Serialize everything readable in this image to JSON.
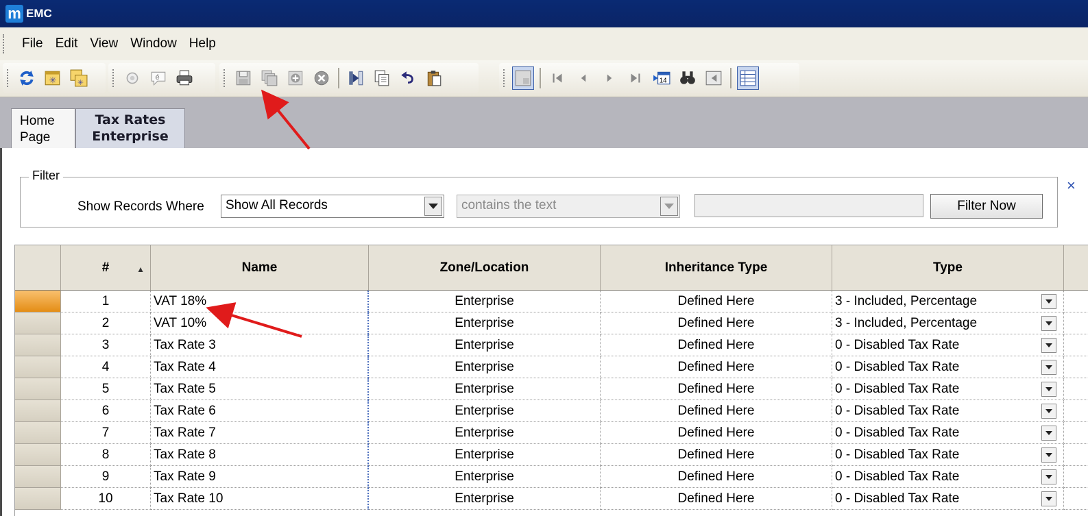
{
  "window": {
    "app_logo": "m",
    "title": "EMC"
  },
  "menu": [
    "File",
    "Edit",
    "View",
    "Window",
    "Help"
  ],
  "toolbar": {
    "icons": [
      "refresh-icon",
      "new-window-icon",
      "multi-window-icon",
      "radio-icon",
      "comment-icon",
      "print-icon",
      "save-icon",
      "save-all-icon",
      "add-record-icon",
      "delete-record-icon",
      "insert-icon",
      "copy-icon",
      "undo-icon",
      "paste-icon",
      "grid-view-icon",
      "first-record-icon",
      "previous-record-icon",
      "next-record-icon",
      "last-record-icon",
      "goto-record-icon",
      "find-icon",
      "table-view-icon",
      "form-view-icon"
    ],
    "goto_badge": "14"
  },
  "tabs": [
    {
      "line1": "Home",
      "line2": "Page"
    },
    {
      "line1": "Tax Rates",
      "line2": "Enterprise"
    }
  ],
  "filter": {
    "legend": "Filter",
    "label": "Show Records Where",
    "field_value": "Show All Records",
    "operator_value": "contains the text",
    "button": "Filter Now",
    "side_link": "×"
  },
  "grid": {
    "columns": [
      "",
      "#",
      "Name",
      "Zone/Location",
      "Inheritance Type",
      "Type"
    ],
    "rows": [
      {
        "num": "1",
        "name": "VAT 18%",
        "zone": "Enterprise",
        "inheritance": "Defined Here",
        "type": "3 - Included, Percentage"
      },
      {
        "num": "2",
        "name": "VAT 10%",
        "zone": "Enterprise",
        "inheritance": "Defined Here",
        "type": "3 - Included, Percentage"
      },
      {
        "num": "3",
        "name": "Tax Rate 3",
        "zone": "Enterprise",
        "inheritance": "Defined Here",
        "type": "0 - Disabled Tax Rate"
      },
      {
        "num": "4",
        "name": "Tax Rate 4",
        "zone": "Enterprise",
        "inheritance": "Defined Here",
        "type": "0 - Disabled Tax Rate"
      },
      {
        "num": "5",
        "name": "Tax Rate 5",
        "zone": "Enterprise",
        "inheritance": "Defined Here",
        "type": "0 - Disabled Tax Rate"
      },
      {
        "num": "6",
        "name": "Tax Rate 6",
        "zone": "Enterprise",
        "inheritance": "Defined Here",
        "type": "0 - Disabled Tax Rate"
      },
      {
        "num": "7",
        "name": "Tax Rate 7",
        "zone": "Enterprise",
        "inheritance": "Defined Here",
        "type": "0 - Disabled Tax Rate"
      },
      {
        "num": "8",
        "name": "Tax Rate 8",
        "zone": "Enterprise",
        "inheritance": "Defined Here",
        "type": "0 - Disabled Tax Rate"
      },
      {
        "num": "9",
        "name": "Tax Rate 9",
        "zone": "Enterprise",
        "inheritance": "Defined Here",
        "type": "0 - Disabled Tax Rate"
      },
      {
        "num": "10",
        "name": "Tax Rate 10",
        "zone": "Enterprise",
        "inheritance": "Defined Here",
        "type": "0 - Disabled Tax Rate"
      }
    ]
  },
  "colors": {
    "titlebar": "#0b2466",
    "annotation": "#e01b1b",
    "current_row": "#e48d15"
  }
}
